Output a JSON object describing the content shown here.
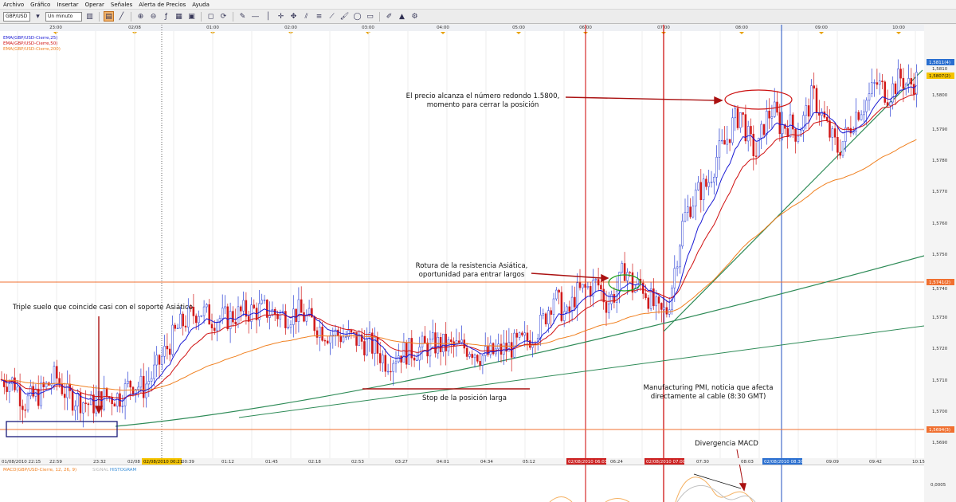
{
  "menu": [
    "Archivo",
    "Gráfico",
    "Insertar",
    "Operar",
    "Señales",
    "Alerta de Precios",
    "Ayuda"
  ],
  "toolbar": {
    "symbol": "GBP/USD",
    "timeframe": "Un minuto"
  },
  "legend": [
    "EMA(GBP/USD-Cierre,25)",
    "EMA(GBP/USD-Cierre,50)",
    "EMA(GBP/USD-Cierre,200)"
  ],
  "macd_legend": {
    "macd": "MACD(GBP/USD-Cierre, 12, 26, 9)",
    "signal": "SIGNAL",
    "hist": "HISTOGRAM"
  },
  "top_times": [
    "23:00",
    "02/08",
    "01:00",
    "02:00",
    "03:00",
    "04:00",
    "05:00",
    "06:00",
    "07:00",
    "08:00",
    "09:00",
    "10:00"
  ],
  "bottom_times": [
    "01/08/2010 22:15",
    "22:59",
    "23:32",
    "02/08",
    "00:39",
    "01:12",
    "01:45",
    "02:18",
    "02:53",
    "03:27",
    "04:01",
    "04:34",
    "05:12",
    "06:24",
    "07:30",
    "08:03",
    "09:09",
    "09:42",
    "10:15"
  ],
  "bottom_tags": [
    "02/08/2010 00:21",
    "02/08/2010 06:03",
    "02/08/2010 07:00",
    "02/08/2010 08:30"
  ],
  "price_labels": [
    "1,5810",
    "1,5800",
    "1,5790",
    "1,5780",
    "1,5770",
    "1,5760",
    "1,5750",
    "1,5740",
    "1,5730",
    "1,5720",
    "1,5710",
    "1,5700",
    "1,5690"
  ],
  "price_tags": {
    "bid": "1,5811(4)",
    "ask": "1,5807(2)",
    "res": "1,5741(2)",
    "sup": "1,5694(3)"
  },
  "macd_label": "0,0005",
  "annotations": {
    "triple": "Triple suelo que coincide casi con el soporte Asiático",
    "stop": "Stop de la posición larga",
    "breakout_1": "Rotura de la resistencia Asiática,",
    "breakout_2": "oportunidad para entrar largos",
    "target_1": "El precio alcanza el número redondo 1.5800,",
    "target_2": "momento para cerrar la posición",
    "pmi_1": "Manufacturing PMI, noticia que afecta",
    "pmi_2": "directamente al cable (8:30 GMT)",
    "divergence": "Divergencia MACD"
  },
  "chart_data": {
    "type": "candlestick",
    "symbol": "GBP/USD",
    "timeframe": "1 minute",
    "y_range": [
      1.5685,
      1.5818
    ],
    "support": 1.5694,
    "resistance": 1.5741,
    "target": 1.58,
    "path": [
      [
        0,
        1.5705
      ],
      [
        18,
        1.5704
      ],
      [
        30,
        1.5697
      ],
      [
        50,
        1.57
      ],
      [
        70,
        1.5706
      ],
      [
        85,
        1.5699
      ],
      [
        100,
        1.5698
      ],
      [
        115,
        1.5696
      ],
      [
        130,
        1.5699
      ],
      [
        150,
        1.5699
      ],
      [
        165,
        1.5704
      ],
      [
        180,
        1.5702
      ],
      [
        195,
        1.5708
      ],
      [
        210,
        1.5716
      ],
      [
        222,
        1.5722
      ],
      [
        235,
        1.5726
      ],
      [
        250,
        1.5729
      ],
      [
        265,
        1.5726
      ],
      [
        285,
        1.5726
      ],
      [
        305,
        1.5728
      ],
      [
        330,
        1.5729
      ],
      [
        355,
        1.5727
      ],
      [
        375,
        1.5728
      ],
      [
        395,
        1.5724
      ],
      [
        410,
        1.5721
      ],
      [
        430,
        1.572
      ],
      [
        455,
        1.5718
      ],
      [
        470,
        1.5716
      ],
      [
        485,
        1.5711
      ],
      [
        500,
        1.5714
      ],
      [
        520,
        1.5715
      ],
      [
        545,
        1.5717
      ],
      [
        570,
        1.5716
      ],
      [
        590,
        1.5716
      ],
      [
        605,
        1.5713
      ],
      [
        620,
        1.5714
      ],
      [
        640,
        1.5716
      ],
      [
        660,
        1.5718
      ],
      [
        680,
        1.5724
      ],
      [
        695,
        1.5734
      ],
      [
        705,
        1.5729
      ],
      [
        712,
        1.5726
      ],
      [
        722,
        1.5734
      ],
      [
        735,
        1.5736
      ],
      [
        750,
        1.5738
      ],
      [
        762,
        1.5731
      ],
      [
        775,
        1.5736
      ],
      [
        785,
        1.5744
      ],
      [
        795,
        1.5736
      ],
      [
        805,
        1.5738
      ],
      [
        815,
        1.5733
      ],
      [
        828,
        1.5727
      ],
      [
        838,
        1.5729
      ],
      [
        848,
        1.5745
      ],
      [
        858,
        1.576
      ],
      [
        868,
        1.5766
      ],
      [
        878,
        1.577
      ],
      [
        888,
        1.5772
      ],
      [
        900,
        1.5782
      ],
      [
        910,
        1.5786
      ],
      [
        920,
        1.5793
      ],
      [
        930,
        1.5797
      ],
      [
        940,
        1.5787
      ],
      [
        950,
        1.5782
      ],
      [
        960,
        1.5794
      ],
      [
        970,
        1.5798
      ],
      [
        980,
        1.5792
      ],
      [
        990,
        1.5793
      ],
      [
        1000,
        1.579
      ],
      [
        1010,
        1.5795
      ],
      [
        1020,
        1.5803
      ],
      [
        1030,
        1.5797
      ],
      [
        1042,
        1.5789
      ],
      [
        1052,
        1.5784
      ],
      [
        1062,
        1.5789
      ],
      [
        1075,
        1.5797
      ],
      [
        1088,
        1.5801
      ],
      [
        1100,
        1.5807
      ],
      [
        1115,
        1.5803
      ],
      [
        1130,
        1.5809
      ],
      [
        1140,
        1.5806
      ],
      [
        1150,
        1.5808
      ]
    ]
  }
}
